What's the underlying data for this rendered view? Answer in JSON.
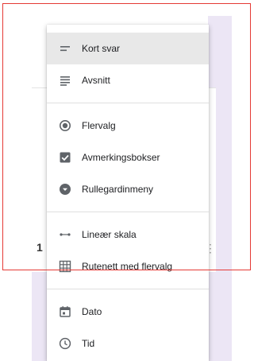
{
  "menu": {
    "items": [
      {
        "label": "Kort svar",
        "icon": "short-text-icon",
        "selected": true
      },
      {
        "label": "Avsnitt",
        "icon": "paragraph-icon"
      },
      {
        "label": "Flervalg",
        "icon": "radio-button-icon"
      },
      {
        "label": "Avmerkingsbokser",
        "icon": "checkbox-icon"
      },
      {
        "label": "Rullegardinmeny",
        "icon": "dropdown-icon"
      },
      {
        "label": "Lineær skala",
        "icon": "linear-scale-icon"
      },
      {
        "label": "Rutenett med flervalg",
        "icon": "grid-icon"
      },
      {
        "label": "Dato",
        "icon": "calendar-icon"
      },
      {
        "label": "Tid",
        "icon": "clock-icon"
      }
    ]
  },
  "background": {
    "question_number": "1"
  },
  "colors": {
    "highlight_frame": "#e53935",
    "lavender": "#ece6f5",
    "icon_gray": "#5f6368",
    "selected_row": "#e8e8e8"
  }
}
